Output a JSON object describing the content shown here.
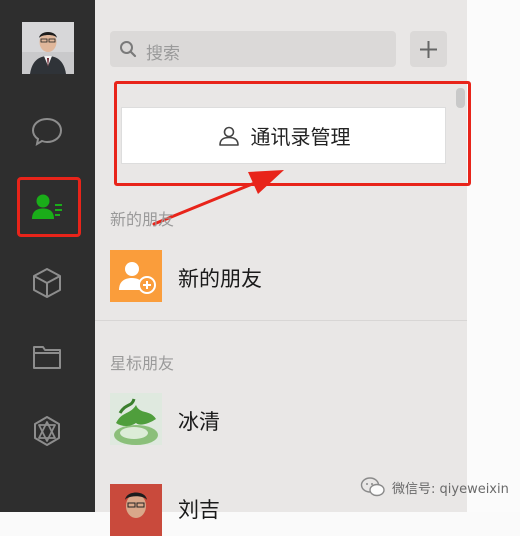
{
  "search": {
    "placeholder": "搜索"
  },
  "contacts_management": {
    "label": "通讯录管理"
  },
  "sections": {
    "new_friends": {
      "header": "新的朋友",
      "item": "新的朋友"
    },
    "starred": {
      "header": "星标朋友",
      "items": [
        "冰清",
        "刘吉"
      ]
    }
  },
  "watermark": {
    "text": "微信号: qiyeweixin"
  },
  "colors": {
    "highlight": "#e8241a",
    "active_icon": "#1aad19",
    "new_friend_bg": "#fa9d3b",
    "sidebar_bg": "#2e2e2e"
  }
}
